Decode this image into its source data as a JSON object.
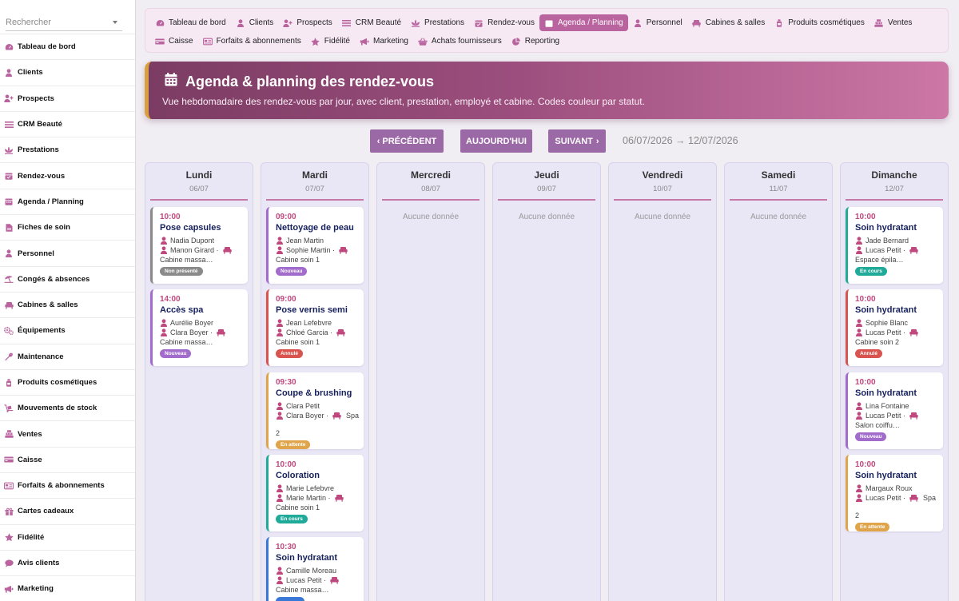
{
  "search": {
    "placeholder": "Rechercher"
  },
  "sidebar": {
    "items": [
      {
        "label": "Tableau de bord",
        "icon": "dashboard-icon"
      },
      {
        "label": "Clients",
        "icon": "user-icon"
      },
      {
        "label": "Prospects",
        "icon": "user-plus-icon"
      },
      {
        "label": "CRM Beauté",
        "icon": "list-icon"
      },
      {
        "label": "Prestations",
        "icon": "spa-icon"
      },
      {
        "label": "Rendez-vous",
        "icon": "calendar-check-icon"
      },
      {
        "label": "Agenda / Planning",
        "icon": "calendar-icon"
      },
      {
        "label": "Fiches de soin",
        "icon": "file-icon"
      },
      {
        "label": "Personnel",
        "icon": "user-icon"
      },
      {
        "label": "Congés & absences",
        "icon": "umbrella-beach-icon"
      },
      {
        "label": "Cabines & salles",
        "icon": "couch-icon"
      },
      {
        "label": "Équipements",
        "icon": "gears-icon"
      },
      {
        "label": "Maintenance",
        "icon": "wrench-icon"
      },
      {
        "label": "Produits cosmétiques",
        "icon": "bottle-icon"
      },
      {
        "label": "Mouvements de stock",
        "icon": "dolly-icon"
      },
      {
        "label": "Ventes",
        "icon": "cash-register-icon"
      },
      {
        "label": "Caisse",
        "icon": "cash-icon"
      },
      {
        "label": "Forfaits & abonnements",
        "icon": "card-icon"
      },
      {
        "label": "Cartes cadeaux",
        "icon": "gift-icon"
      },
      {
        "label": "Fidélité",
        "icon": "star-icon"
      },
      {
        "label": "Avis clients",
        "icon": "comment-icon"
      },
      {
        "label": "Marketing",
        "icon": "bullhorn-icon"
      }
    ]
  },
  "topnav": {
    "row1": [
      {
        "label": "Tableau de bord",
        "icon": "dashboard-icon"
      },
      {
        "label": "Clients",
        "icon": "user-icon"
      },
      {
        "label": "Prospects",
        "icon": "user-plus-icon"
      },
      {
        "label": "CRM Beauté",
        "icon": "list-icon"
      },
      {
        "label": "Prestations",
        "icon": "spa-icon"
      },
      {
        "label": "Rendez-vous",
        "icon": "calendar-check-icon"
      },
      {
        "label": "Agenda / Planning",
        "icon": "calendar-icon",
        "active": true
      },
      {
        "label": "Personnel",
        "icon": "user-icon"
      },
      {
        "label": "Cabines & salles",
        "icon": "couch-icon"
      },
      {
        "label": "Produits cosmétiques",
        "icon": "bottle-icon"
      },
      {
        "label": "Ventes",
        "icon": "cash-register-icon"
      }
    ],
    "row2": [
      {
        "label": "Caisse",
        "icon": "cash-icon"
      },
      {
        "label": "Forfaits & abonnements",
        "icon": "card-icon"
      },
      {
        "label": "Fidélité",
        "icon": "star-icon"
      },
      {
        "label": "Marketing",
        "icon": "bullhorn-icon"
      },
      {
        "label": "Achats fournisseurs",
        "icon": "basket-icon"
      },
      {
        "label": "Reporting",
        "icon": "pie-chart-icon"
      }
    ]
  },
  "banner": {
    "title": "Agenda & planning des rendez-vous",
    "subtitle": "Vue hebdomadaire des rendez-vous par jour, avec client, prestation, employé et cabine. Codes couleur par statut."
  },
  "pager": {
    "prev": "PRÉCÉDENT",
    "today": "AUJOURD'HUI",
    "next": "SUIVANT",
    "range": "06/07/2026 → 12/07/2026"
  },
  "empty_label": "Aucune donnée",
  "colors": {
    "accent": "#b9639f",
    "pager": "#9b6aa6",
    "time": "#c0487e",
    "service": "#16205c"
  },
  "statuses": {
    "Non présenté": "#8a8a8a",
    "Nouveau": "#a26ccc",
    "Annulé": "#d9534f",
    "En attente": "#e0a54a",
    "En cours": "#1faa9a"
  },
  "days": [
    {
      "name": "Lundi",
      "date": "06/07",
      "appts": [
        {
          "time": "10:00",
          "service": "Pose capsules",
          "client": "Nadia Dupont",
          "staff": "Manon Girard ·",
          "room": "Cabine massa…",
          "status": "Non présenté"
        },
        {
          "time": "14:00",
          "service": "Accès spa",
          "client": "Aurélie Boyer",
          "staff": "Clara Boyer ·",
          "room": "Cabine massa…",
          "status": "Nouveau"
        }
      ]
    },
    {
      "name": "Mardi",
      "date": "07/07",
      "appts": [
        {
          "time": "09:00",
          "service": "Nettoyage de peau",
          "client": "Jean Martin",
          "staff": "Sophie Martin ·",
          "room": "Cabine soin 1",
          "status": "Nouveau"
        },
        {
          "time": "09:00",
          "service": "Pose vernis semi",
          "client": "Jean Lefebvre",
          "staff": "Chloé Garcia ·",
          "room": "Cabine soin 1",
          "status": "Annulé"
        },
        {
          "time": "09:30",
          "service": "Coupe & brushing",
          "client": "Clara Petit",
          "staff": "Clara Boyer ·",
          "room_inline": "Spa",
          "room": "2",
          "status": "En attente"
        },
        {
          "time": "10:00",
          "service": "Coloration",
          "client": "Marie Lefebvre",
          "staff": "Marie Martin ·",
          "room": "Cabine soin 1",
          "status": "En cours"
        },
        {
          "time": "10:30",
          "service": "Soin hydratant",
          "client": "Camille Moreau",
          "staff": "Lucas Petit ·",
          "room": "Cabine massa…",
          "status": ""
        }
      ]
    },
    {
      "name": "Mercredi",
      "date": "08/07",
      "appts": []
    },
    {
      "name": "Jeudi",
      "date": "09/07",
      "appts": []
    },
    {
      "name": "Vendredi",
      "date": "10/07",
      "appts": []
    },
    {
      "name": "Samedi",
      "date": "11/07",
      "appts": []
    },
    {
      "name": "Dimanche",
      "date": "12/07",
      "appts": [
        {
          "time": "10:00",
          "service": "Soin hydratant",
          "client": "Jade Bernard",
          "staff": "Lucas Petit ·",
          "room": "Espace épila…",
          "status": "En cours"
        },
        {
          "time": "10:00",
          "service": "Soin hydratant",
          "client": "Sophie Blanc",
          "staff": "Lucas Petit ·",
          "room": "Cabine soin 2",
          "status": "Annulé"
        },
        {
          "time": "10:00",
          "service": "Soin hydratant",
          "client": "Lina Fontaine",
          "staff": "Lucas Petit ·",
          "room": "Salon coiffu…",
          "status": "Nouveau"
        },
        {
          "time": "10:00",
          "service": "Soin hydratant",
          "client": "Margaux Roux",
          "staff": "Lucas Petit ·",
          "room_inline": "Spa",
          "room": "2",
          "status": "En attente"
        }
      ]
    }
  ]
}
